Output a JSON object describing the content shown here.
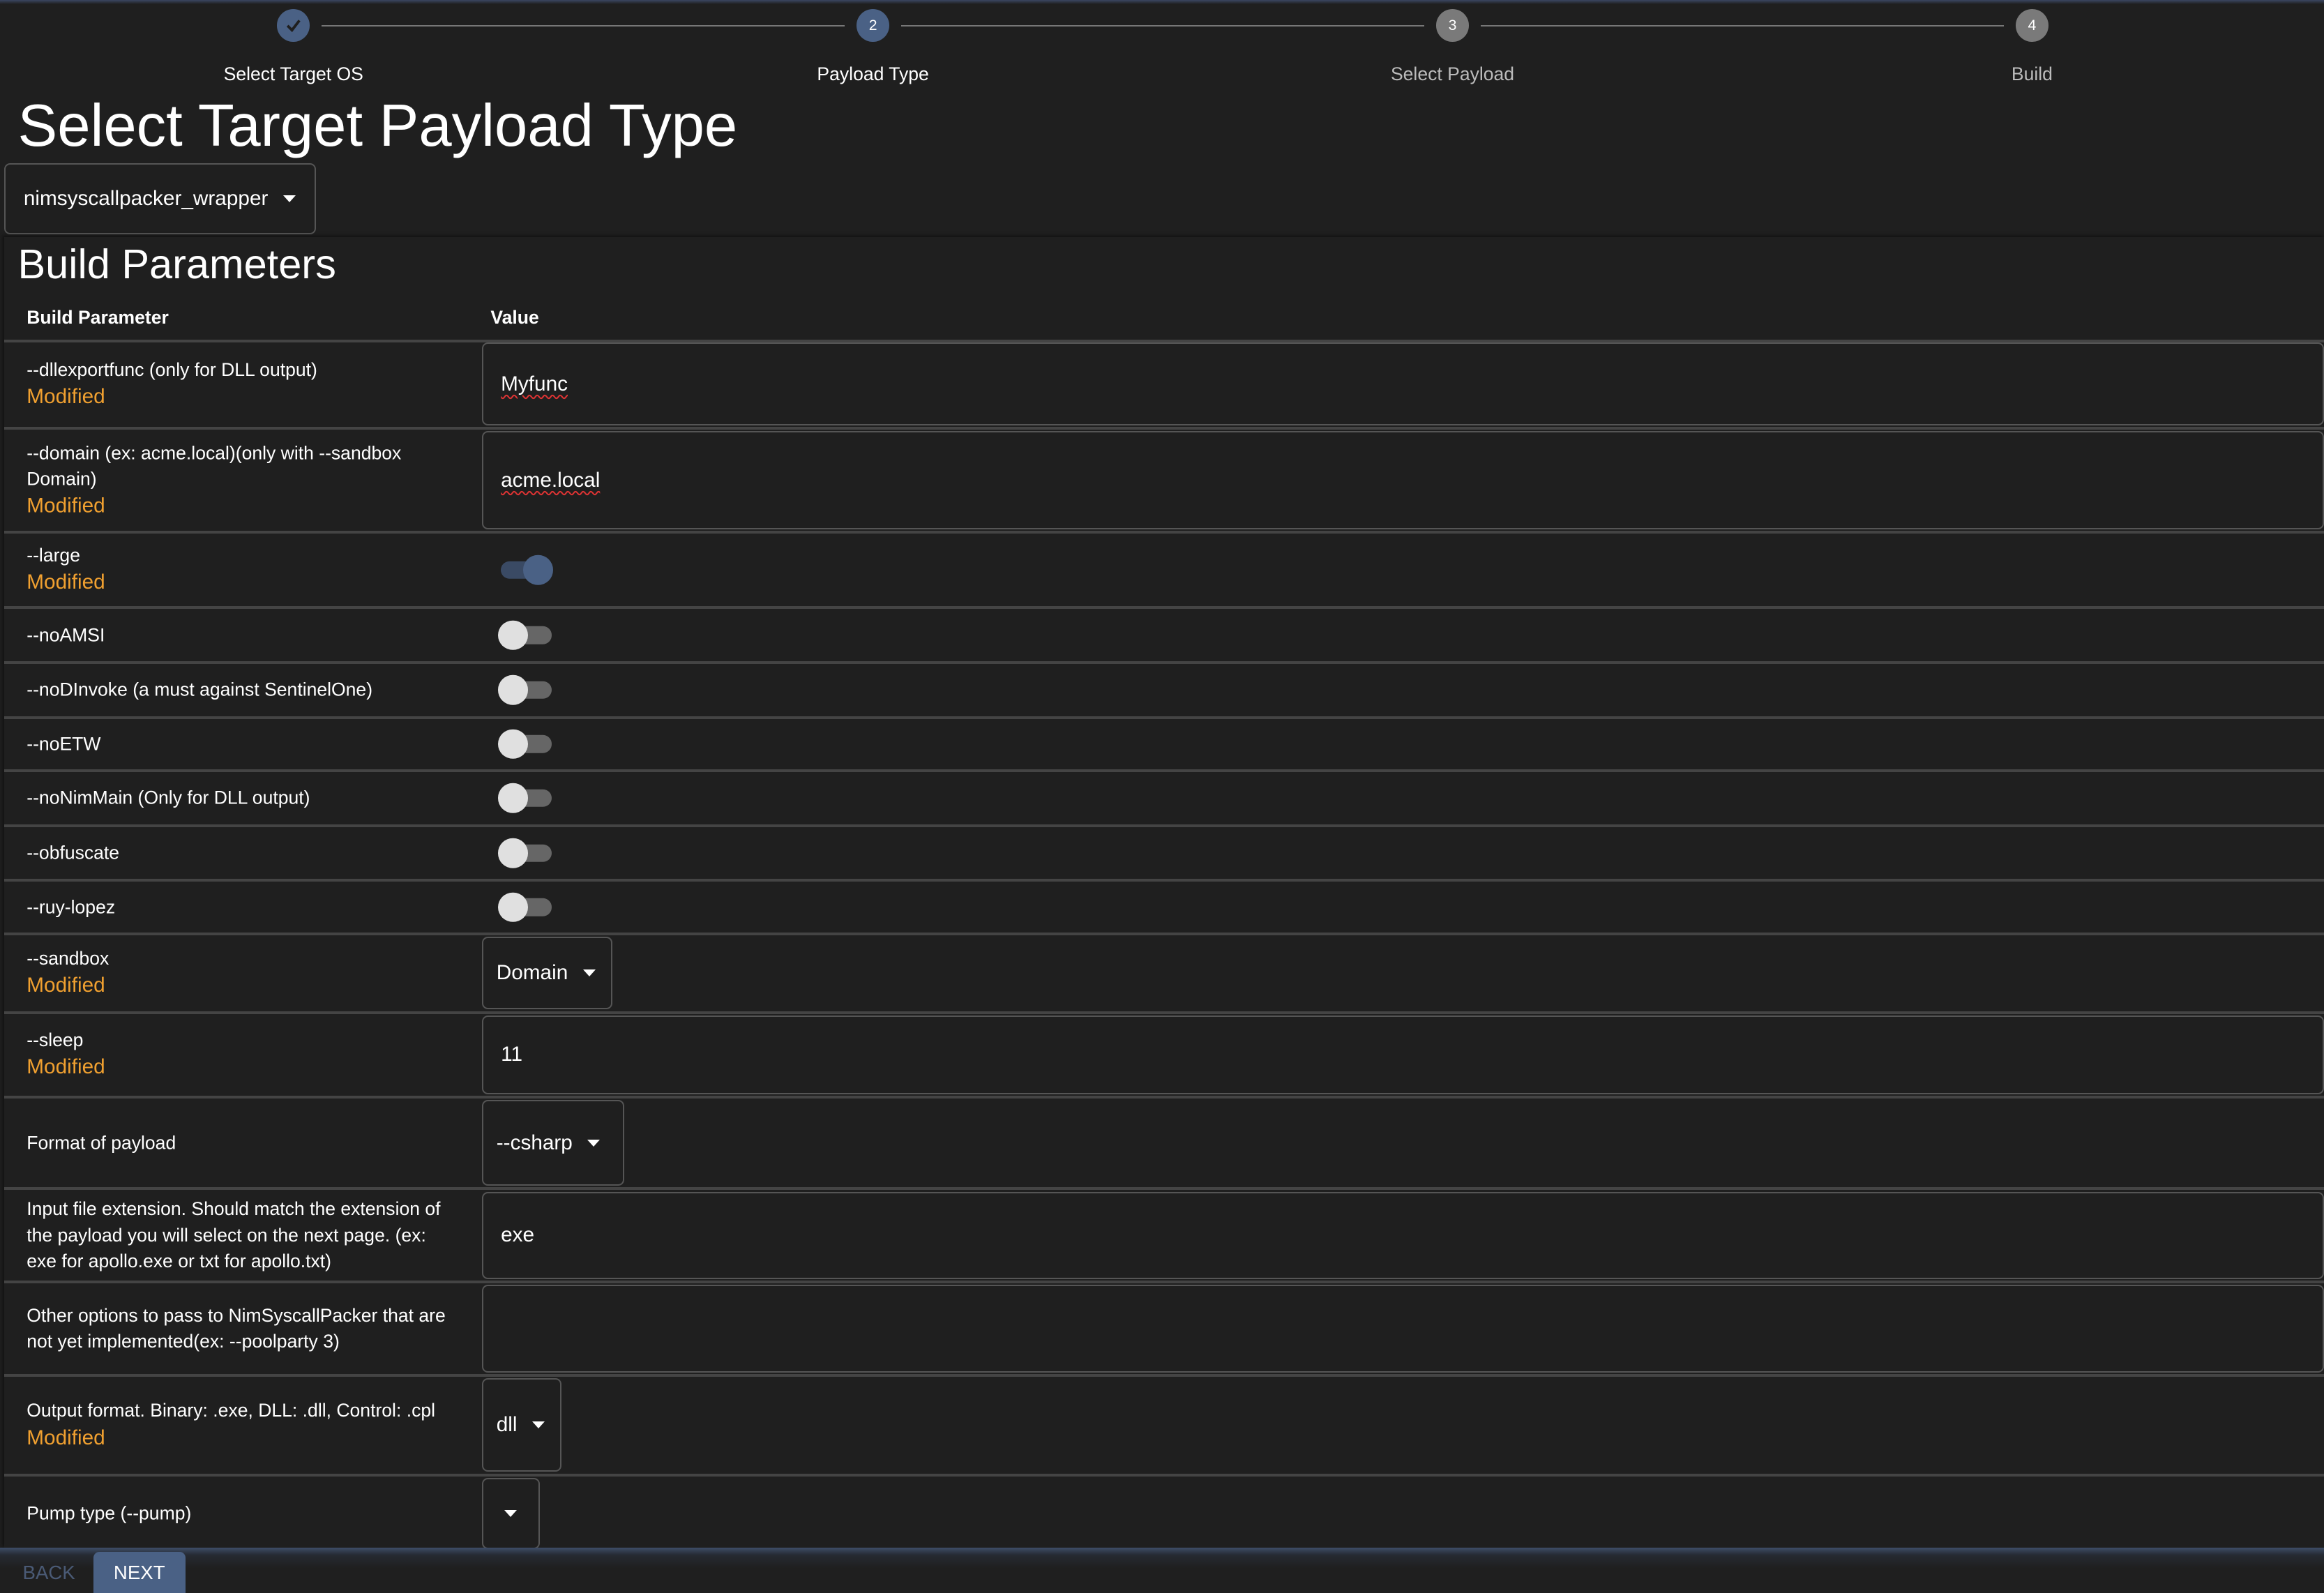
{
  "stepper": {
    "steps": [
      {
        "label": "Select Target OS",
        "number": "1",
        "state": "completed"
      },
      {
        "label": "Payload Type",
        "number": "2",
        "state": "active"
      },
      {
        "label": "Select Payload",
        "number": "3",
        "state": "todo"
      },
      {
        "label": "Build",
        "number": "4",
        "state": "todo"
      }
    ]
  },
  "page_title": "Select Target Payload Type",
  "payload_type_select": {
    "value": "nimsyscallpacker_wrapper"
  },
  "build_parameters": {
    "title": "Build Parameters",
    "col_param": "Build Parameter",
    "col_value": "Value",
    "modified_label": "Modified",
    "rows": [
      {
        "name": "--dllexportfunc (only for DLL output)",
        "modified": true,
        "type": "text",
        "value": "Myfunc",
        "spell": true
      },
      {
        "name": "--domain (ex: acme.local)(only with --sandbox Domain)",
        "modified": true,
        "type": "text",
        "value": "acme.local",
        "spell": true
      },
      {
        "name": "--large",
        "modified": true,
        "type": "toggle",
        "checked": true
      },
      {
        "name": "--noAMSI",
        "modified": false,
        "type": "toggle",
        "checked": false
      },
      {
        "name": "--noDInvoke (a must against SentinelOne)",
        "modified": false,
        "type": "toggle",
        "checked": false
      },
      {
        "name": "--noETW",
        "modified": false,
        "type": "toggle",
        "checked": false
      },
      {
        "name": "--noNimMain (Only for DLL output)",
        "modified": false,
        "type": "toggle",
        "checked": false
      },
      {
        "name": "--obfuscate",
        "modified": false,
        "type": "toggle",
        "checked": false
      },
      {
        "name": "--ruy-lopez",
        "modified": false,
        "type": "toggle",
        "checked": false
      },
      {
        "name": "--sandbox",
        "modified": true,
        "type": "select",
        "value": "Domain"
      },
      {
        "name": "--sleep",
        "modified": true,
        "type": "text",
        "value": "11"
      },
      {
        "name": "Format of payload",
        "modified": false,
        "type": "select",
        "value": "--csharp"
      },
      {
        "name": "Input file extension. Should match the extension of the payload you will select on the next page. (ex: exe for apollo.exe or txt for apollo.txt)",
        "modified": false,
        "type": "text",
        "value": "exe"
      },
      {
        "name": "Other options to pass to NimSyscallPacker that are not yet implemented(ex: --poolparty 3)",
        "modified": false,
        "type": "text",
        "value": ""
      },
      {
        "name": "Output format. Binary: .exe, DLL: .dll, Control: .cpl",
        "modified": true,
        "type": "select",
        "value": "dll"
      },
      {
        "name": "Pump type (--pump)",
        "modified": false,
        "type": "select",
        "value": ""
      }
    ]
  },
  "footer": {
    "back_label": "BACK",
    "next_label": "NEXT"
  },
  "colors": {
    "accent": "#4a6185",
    "modified": "#f0a030",
    "background": "#1f1f1f"
  }
}
